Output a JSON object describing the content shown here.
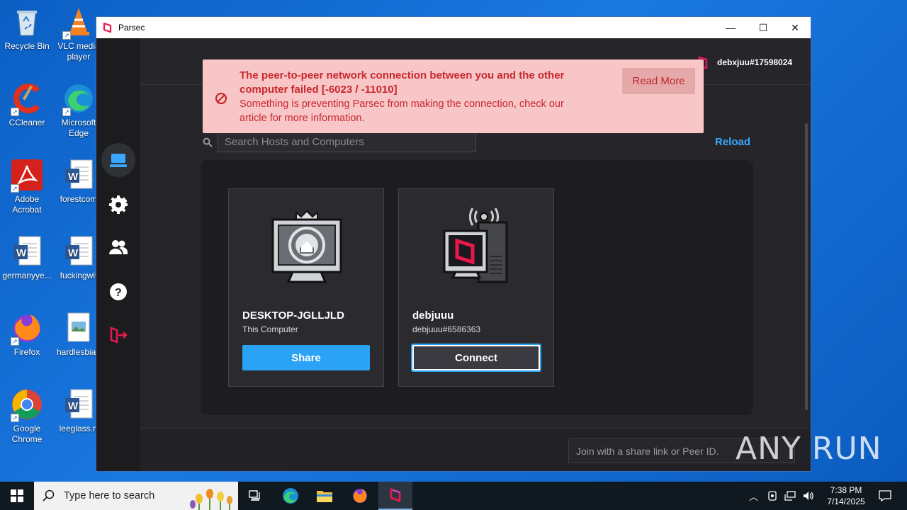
{
  "desktop": {
    "icons": [
      {
        "label": "Recycle Bin"
      },
      {
        "label": "VLC media player"
      },
      {
        "label": "CCleaner"
      },
      {
        "label": "Microsoft Edge"
      },
      {
        "label": "Adobe Acrobat"
      },
      {
        "label": "forestcom"
      },
      {
        "label": "germanyye..."
      },
      {
        "label": "fuckingwit"
      },
      {
        "label": "Firefox"
      },
      {
        "label": "hardlesbian"
      },
      {
        "label": "Google Chrome"
      },
      {
        "label": "leeglass.rt"
      }
    ]
  },
  "window": {
    "title": "Parsec",
    "minimize": "—",
    "maximize": "☐",
    "close": "✕"
  },
  "user": {
    "name": "debxjuu#17598024"
  },
  "error": {
    "title": "The peer-to-peer network connection between you and the other computer failed [-6023 / -11010]",
    "message": "Something is preventing Parsec from making the connection, check our article for more information.",
    "action": "Read More"
  },
  "search": {
    "placeholder": "Search Hosts and Computers"
  },
  "reload": "Reload",
  "hosts": [
    {
      "name": "DESKTOP-JGLLJLD",
      "sub": "This Computer",
      "button": "Share"
    },
    {
      "name": "debjuuu",
      "sub": "debjuuu#6586363",
      "button": "Connect"
    }
  ],
  "peer": {
    "placeholder": "Join with a share link or Peer ID."
  },
  "taskbar": {
    "search_text": "Type here to search",
    "time": "7:38 PM",
    "date": "7/14/2025"
  },
  "watermark": "ANY RUN",
  "colors": {
    "accent": "#2aa2f5",
    "error_bg": "#f8c6c6",
    "error_text": "#c8282e",
    "brand": "#e8184f"
  }
}
